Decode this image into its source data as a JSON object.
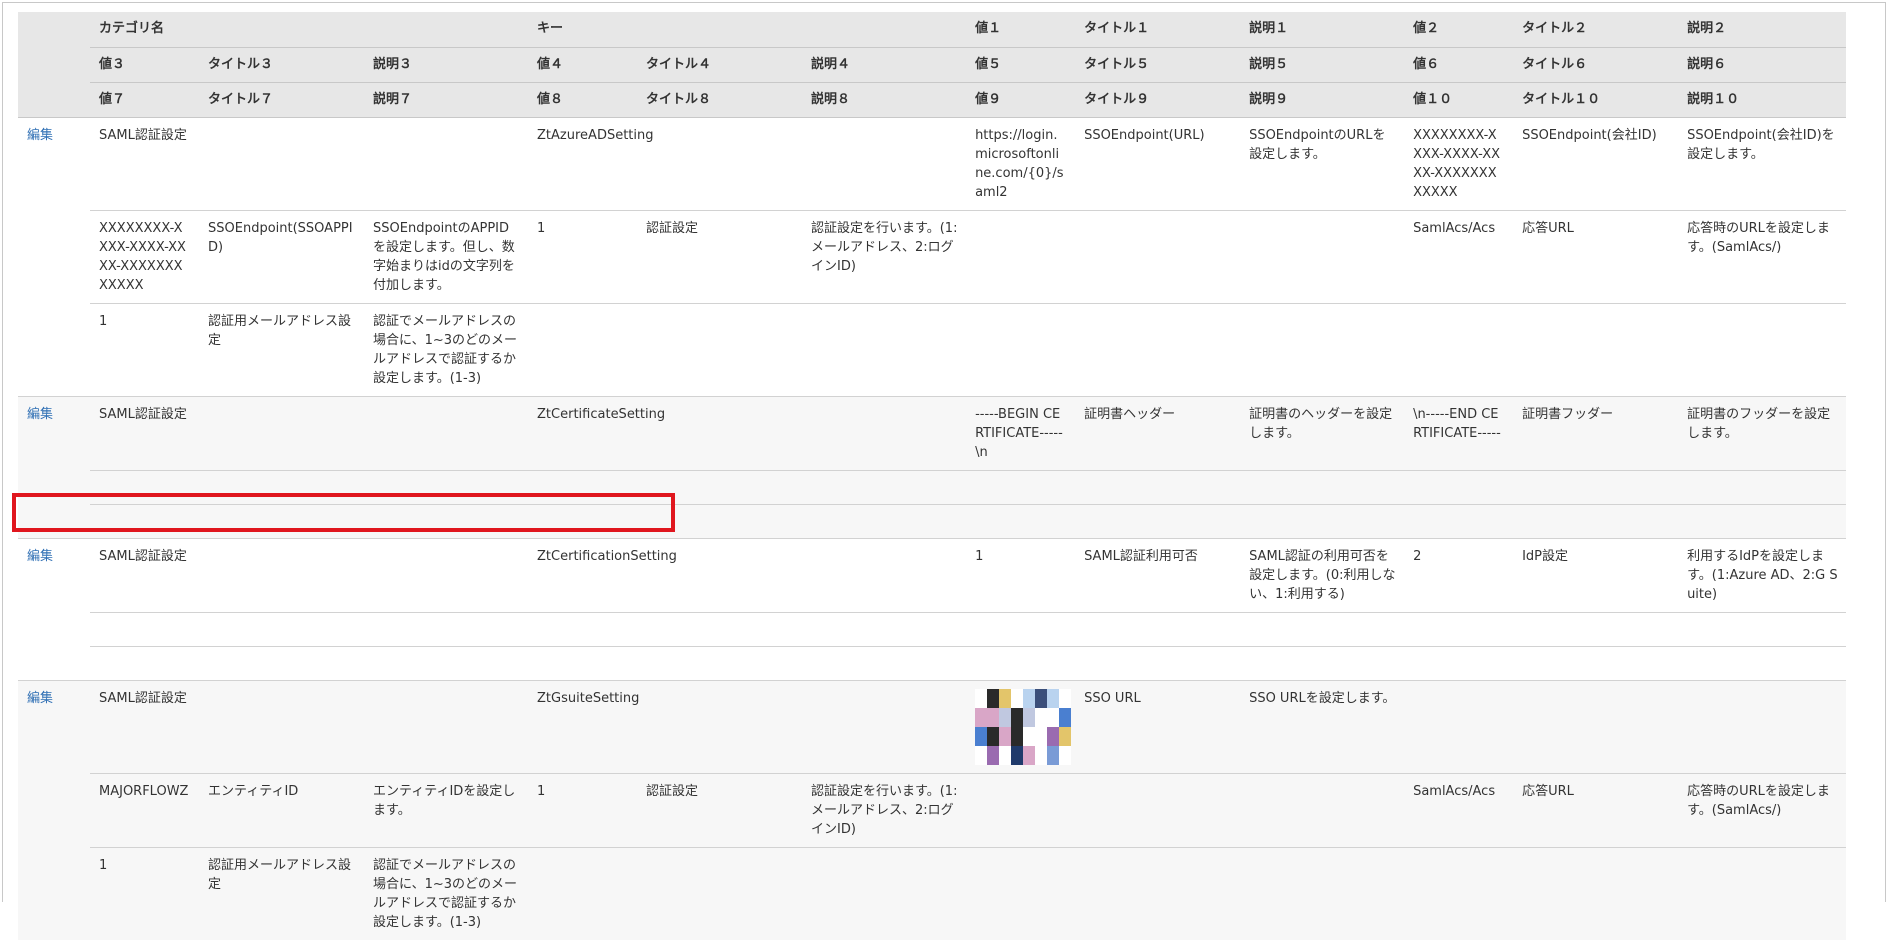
{
  "header_rows": [
    [
      "カテゴリ名",
      "キー",
      "値１",
      "タイトル１",
      "説明１",
      "値２",
      "タイトル２",
      "説明２"
    ],
    [
      "値３",
      "タイトル３",
      "説明３",
      "値４",
      "タイトル４",
      "説明４",
      "値５",
      "タイトル５",
      "説明５",
      "値６",
      "タイトル６",
      "説明６"
    ],
    [
      "値７",
      "タイトル７",
      "説明７",
      "値８",
      "タイトル８",
      "説明８",
      "値９",
      "タイトル９",
      "説明９",
      "値１０",
      "タイトル１０",
      "説明１０"
    ]
  ],
  "edit_label": "編集",
  "records": [
    {
      "row1": {
        "category": "SAML認証設定",
        "key": "ZtAzureADSetting",
        "value1": "https://login.microsoftonline.com/{0}/saml2",
        "title1": "SSOEndpoint(URL)",
        "desc1": "SSOEndpointのURLを設定します。",
        "value2": "XXXXXXXX-XXXX-XXXX-XXXX-XXXXXXXXXXXX",
        "title2": "SSOEndpoint(会社ID)",
        "desc2": "SSOEndpoint(会社ID)を設定します。"
      },
      "row2": [
        "XXXXXXXX-XXXX-XXXX-XXXX-XXXXXXXXXXXX",
        "SSOEndpoint(SSOAPPID)",
        "SSOEndpointのAPPIDを設定します。但し、数字始まりはidの文字列を付加します。",
        "1",
        "認証設定",
        "認証設定を行います。(1:メールアドレス、2:ログインID)",
        "",
        "",
        "",
        "SamlAcs/Acs",
        "応答URL",
        "応答時のURLを設定します。(SamlAcs/)"
      ],
      "row3": [
        "1",
        "認証用メールアドレス設定",
        "認証でメールアドレスの場合に、1~3のどのメールアドレスで認証するか設定します。(1-3)",
        "",
        "",
        "",
        "",
        "",
        "",
        "",
        "",
        ""
      ]
    },
    {
      "row1": {
        "category": "SAML認証設定",
        "key": "ZtCertificateSetting",
        "value1": "-----BEGIN CERTIFICATE-----\\n",
        "title1": "証明書ヘッダー",
        "desc1": "証明書のヘッダーを設定します。",
        "value2": "\\n-----END CERTIFICATE-----",
        "title2": "証明書フッダー",
        "desc2": "証明書のフッダーを設定します。"
      },
      "row2": [
        "",
        "",
        "",
        "",
        "",
        "",
        "",
        "",
        "",
        "",
        "",
        ""
      ],
      "row3": [
        "",
        "",
        "",
        "",
        "",
        "",
        "",
        "",
        "",
        "",
        "",
        ""
      ]
    },
    {
      "row1": {
        "category": "SAML認証設定",
        "key": "ZtCertificationSetting",
        "value1": "1",
        "title1": "SAML認証利用可否",
        "desc1": "SAML認証の利用可否を設定します。(0:利用しない、1:利用する)",
        "value2": "2",
        "title2": "IdP設定",
        "desc2": "利用するIdPを設定します。(1:Azure AD、2:G Suite)"
      },
      "row2": [
        "",
        "",
        "",
        "",
        "",
        "",
        "",
        "",
        "",
        "",
        "",
        ""
      ],
      "row3": [
        "",
        "",
        "",
        "",
        "",
        "",
        "",
        "",
        "",
        "",
        "",
        ""
      ]
    },
    {
      "row1": {
        "category": "SAML認証設定",
        "key": "ZtGsuiteSetting",
        "value1": "",
        "title1": "SSO URL",
        "desc1": "SSO URLを設定します。",
        "value2": "",
        "title2": "",
        "desc2": ""
      },
      "row2": [
        "MAJORFLOWZ",
        "エンティティID",
        "エンティティIDを設定します。",
        "1",
        "認証設定",
        "認証設定を行います。(1:メールアドレス、2:ログインID)",
        "",
        "",
        "",
        "SamlAcs/Acs",
        "応答URL",
        "応答時のURLを設定します。(SamlAcs/)"
      ],
      "row3": [
        "1",
        "認証用メールアドレス設定",
        "認証でメールアドレスの場合に、1~3のどのメールアドレスで認証するか設定します。(1-3)",
        "",
        "",
        "",
        "",
        "",
        "",
        "",
        "",
        ""
      ]
    }
  ],
  "colors": {
    "highlight": "#e0161e",
    "link": "#2f6fb4",
    "header_bg": "#e7e7e7",
    "alt_row_bg": "#f7f7f7"
  },
  "redacted_image": {
    "icon": "pixelated-mosaic",
    "colors": [
      "#1f3a6b",
      "#4a7fd0",
      "#9a6bb0",
      "#e3c56a",
      "#b9d3ef",
      "#3b4f7a",
      "#d9a6c7",
      "#7a9bd6",
      "#f0e0a0",
      "#2a2a2a",
      "#c0c8e0",
      "#e8eef8"
    ]
  }
}
